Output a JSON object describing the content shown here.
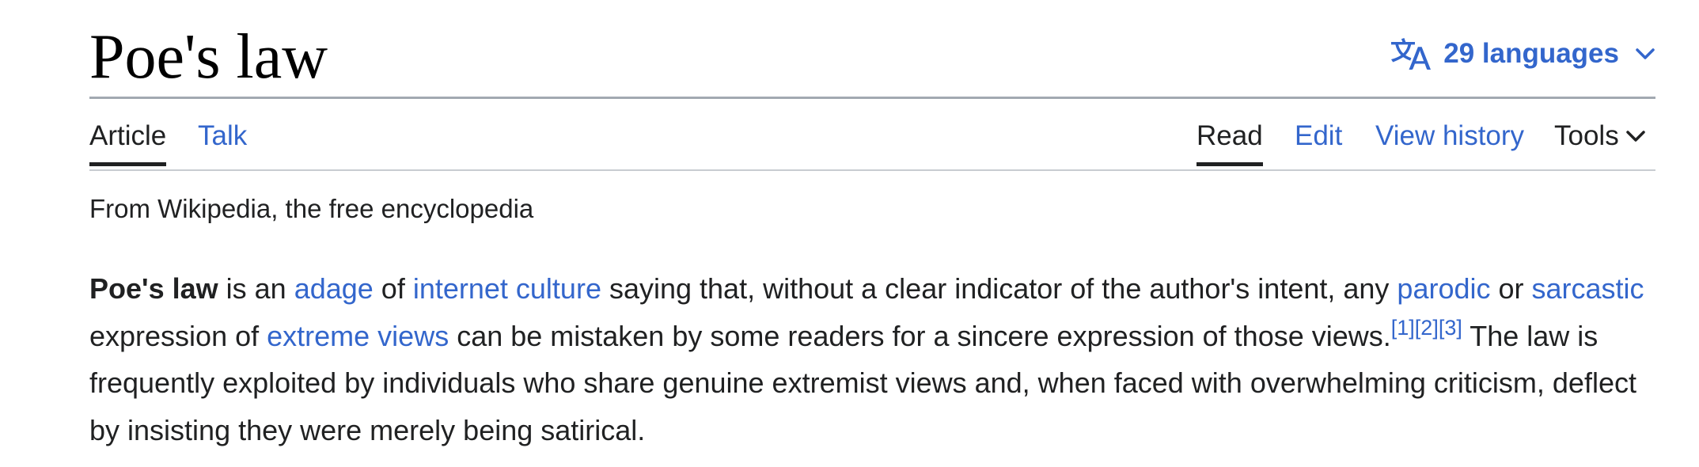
{
  "page": {
    "title": "Poe's law",
    "languages_label": "29 languages",
    "tagline": "From Wikipedia, the free encyclopedia"
  },
  "tabs_left": {
    "article": "Article",
    "talk": "Talk"
  },
  "tabs_right": {
    "read": "Read",
    "edit": "Edit",
    "view_history": "View history",
    "tools": "Tools"
  },
  "lead": {
    "subject": "Poe's law",
    "t1": " is an ",
    "link_adage": "adage",
    "t2": " of ",
    "link_internet_culture": "internet culture",
    "t3": " saying that, without a clear indicator of the author's intent, any ",
    "link_parodic": "parodic",
    "t4": " or ",
    "link_sarcastic": "sarcastic",
    "t5": " expression of ",
    "link_extreme_views": "extreme views",
    "t6": " can be mistaken by some readers for a sincere expression of those views.",
    "ref1": "[1]",
    "ref2": "[2]",
    "ref3": "[3]",
    "t7": " The law is frequently exploited by individuals who share genuine extremist views and, when faced with overwhelming criticism, deflect by insisting they were merely being satirical."
  },
  "colors": {
    "link": "#3366cc",
    "text": "#202122",
    "title_rule": "#a2a9b1",
    "tab_rule": "#c8ccd1"
  },
  "icons": {
    "languages": "translate-icon",
    "languages_chevron": "chevron-down-icon",
    "tools_chevron": "chevron-down-icon"
  }
}
